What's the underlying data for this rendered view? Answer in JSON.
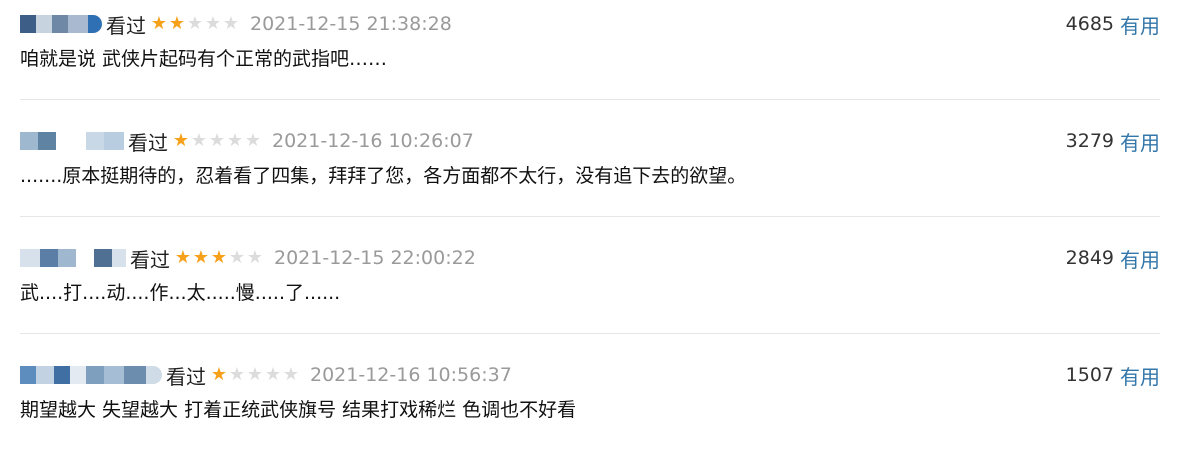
{
  "comments": [
    {
      "status": "看过",
      "rating": 2,
      "time": "2021-12-15 21:38:28",
      "votes": "4685",
      "useful_label": "有用",
      "content": "咱就是说 武侠片起码有个正常的武指吧……",
      "avatar_colors": [
        "#3d5e86",
        "#c8d3e0",
        "#6f88a6",
        "#a9bad0",
        "#2f6fb3"
      ]
    },
    {
      "status": "看过",
      "rating": 1,
      "time": "2021-12-16 10:26:07",
      "votes": "3279",
      "useful_label": "有用",
      "content": ".......原本挺期待的，忍着看了四集，拜拜了您，各方面都不太行，没有追下去的欲望。",
      "avatar_colors": [
        "#9db8cf",
        "#5f83a3",
        "#e6edf3",
        "#c9d8e6",
        "#b8cde0"
      ]
    },
    {
      "status": "看过",
      "rating": 3,
      "time": "2021-12-15 22:00:22",
      "votes": "2849",
      "useful_label": "有用",
      "content": "武....打....动....作...太.....慢.....了......",
      "avatar_colors": [
        "#d6e1ec",
        "#5b7ea6",
        "#9fb7cf",
        "#e9eef3",
        "#4f6f93"
      ]
    },
    {
      "status": "看过",
      "rating": 1,
      "time": "2021-12-16 10:56:37",
      "votes": "1507",
      "useful_label": "有用",
      "content": "期望越大 失望越大 打着正统武侠旗号 结果打戏稀烂 色调也不好看",
      "avatar_colors": [
        "#5d8cbf",
        "#c2d2e2",
        "#3f6fa3",
        "#e3eaf1",
        "#7f9fbf",
        "#a5bdd5",
        "#6d8daf",
        "#cfdbe7"
      ]
    }
  ]
}
